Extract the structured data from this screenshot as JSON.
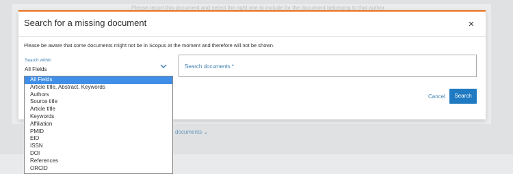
{
  "background": {
    "top_text": "Please report this document and select the right one to include for the document belonging to that author.",
    "link_text": "documents"
  },
  "modal": {
    "title": "Search for a missing document",
    "notice": "Please be aware that some documents might not be in Scopus at the moment and therefore will not be shown.",
    "select_label": "Search within",
    "select_value": "All Fields",
    "search_placeholder": "Search documents *",
    "cancel_label": "Cancel",
    "search_label": "Search"
  },
  "dropdown": {
    "selected_index": 0,
    "options": [
      "All Fields",
      "Article title, Abstract, Keywords",
      "Authors",
      "Source title",
      "Article title",
      "Keywords",
      "Affiliation",
      "PMID",
      "EID",
      "ISSN",
      "DOI",
      "References",
      "ORCID"
    ]
  },
  "colors": {
    "accent": "#1f7ac2",
    "top_border": "#e9711c",
    "selected_option": "#3f8ee8",
    "link": "#3f7fb0"
  }
}
